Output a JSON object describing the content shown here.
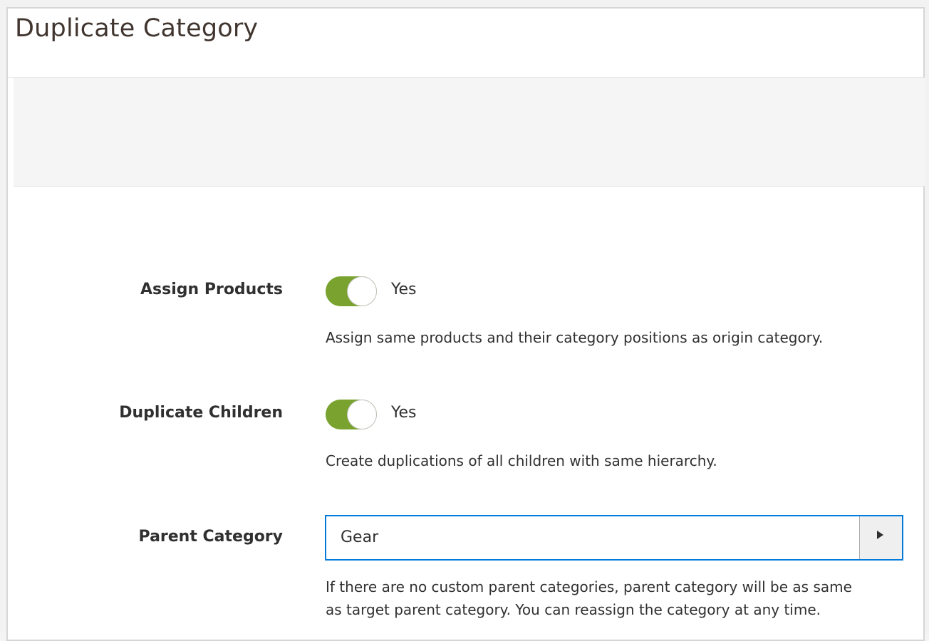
{
  "modal": {
    "title": "Duplicate Category"
  },
  "form": {
    "assign_products": {
      "label": "Assign Products",
      "value_text": "Yes",
      "checked": true,
      "note": "Assign same products and their category positions as origin category."
    },
    "duplicate_children": {
      "label": "Duplicate Children",
      "value_text": "Yes",
      "checked": true,
      "note": "Create duplications of all children with same hierarchy."
    },
    "parent_category": {
      "label": "Parent Category",
      "selected": "Gear",
      "note_line1": "If there are no custom parent categories, parent category will be as same",
      "note_line2": "as target parent category. You can reassign the category at any time."
    }
  },
  "colors": {
    "switch_on": "#79a22e",
    "focus_border": "#007bdb"
  },
  "icons": {
    "select_toggle": "triangle-right-icon"
  }
}
